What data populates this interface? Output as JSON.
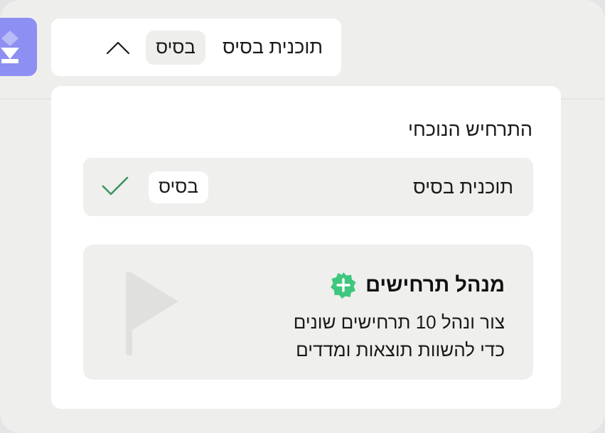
{
  "header": {
    "scenario_title": "תוכנית בסיס",
    "scenario_badge": "בסיס"
  },
  "dropdown": {
    "section_label": "התרחיש הנוכחי",
    "current_scenario": {
      "title": "תוכנית בסיס",
      "badge": "בסיס",
      "selected": true
    },
    "promo": {
      "title": "מנהל תרחישים",
      "line1": "צור ונהל 10 תרחישים שונים",
      "line2": "כדי להשוות תוצאות ומדדים"
    }
  },
  "colors": {
    "logo": "#8d8ff2",
    "check": "#3f9460",
    "plus_badge": "#3fc77f",
    "flag": "#e0e0df"
  },
  "icons": {
    "logo": "logo-icon",
    "chevron": "chevron-up-icon",
    "check": "check-icon",
    "plus": "plus-badge-icon",
    "flag": "flag-icon"
  }
}
